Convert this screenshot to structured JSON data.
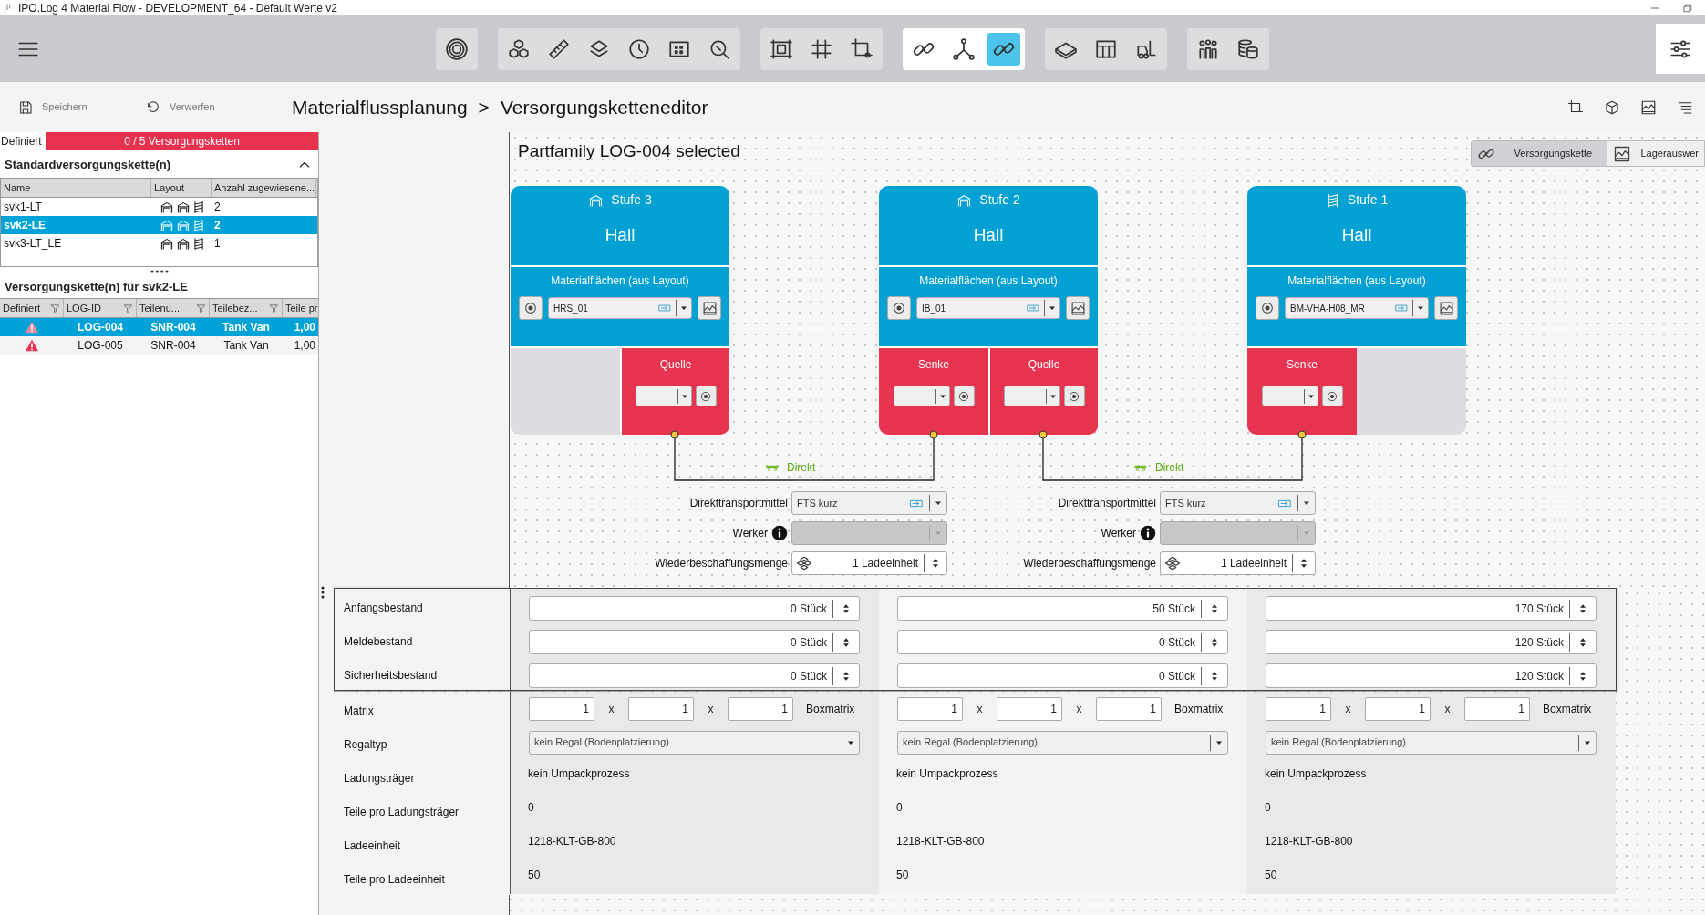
{
  "window": {
    "title": "IPO.Log 4 Material Flow - DEVELOPMENT_64 - Default Werte v2"
  },
  "toolbar": {
    "groups": [
      {
        "active": false,
        "items": [
          {
            "selected": false
          }
        ]
      },
      {
        "active": false,
        "items": [
          {
            "selected": false
          },
          {
            "selected": false
          },
          {
            "selected": false
          },
          {
            "selected": false
          },
          {
            "selected": false
          },
          {
            "selected": false
          }
        ]
      },
      {
        "active": false,
        "items": [
          {
            "selected": false
          },
          {
            "selected": false
          },
          {
            "selected": false
          }
        ]
      },
      {
        "active": true,
        "items": [
          {
            "selected": false
          },
          {
            "selected": false
          },
          {
            "selected": true
          }
        ]
      },
      {
        "active": false,
        "items": [
          {
            "selected": false
          },
          {
            "selected": false
          },
          {
            "selected": false
          }
        ]
      },
      {
        "active": false,
        "items": [
          {
            "selected": false
          },
          {
            "selected": false
          }
        ]
      }
    ]
  },
  "actions": [
    {
      "label": "Speichern",
      "disabled": true
    },
    {
      "label": "Verwerfen",
      "disabled": true
    }
  ],
  "breadcrumb": [
    "Materialflussplanung",
    ">",
    "Versorgungsketteneditor"
  ],
  "left_panel": {
    "defined_label": "Definiert",
    "progress": "0 / 5 Versorgungsketten",
    "level": 0,
    "standard": {
      "title": "Standardversorgungskette(n)",
      "expanded": true,
      "columns": [
        "Name",
        "Layout",
        "Anzahl zugewiesene..."
      ],
      "rows": [
        {
          "name": "svk1-LT",
          "count": "2",
          "selected": false
        },
        {
          "name": "svk2-LE",
          "count": "2",
          "selected": true
        },
        {
          "name": "svk3-LT_LE",
          "count": "1",
          "selected": false
        }
      ]
    },
    "chains": {
      "title": "Versorgungskette(n) für svk2-LE",
      "columns": [
        "Definiert",
        "LOG-ID",
        "Teilenu...",
        "Teilebez...",
        "Teile pr"
      ],
      "rows": [
        {
          "warning": true,
          "log_id": "LOG-004",
          "part_number": "SNR-004",
          "part_name": "Tank Van",
          "quantity": "1,00",
          "selected": true
        },
        {
          "warning": true,
          "log_id": "LOG-005",
          "part_number": "SNR-004",
          "part_name": "Tank Van",
          "quantity": "1,00",
          "selected": false
        }
      ]
    }
  },
  "canvas": {
    "title": "Partfamily LOG-004 selected",
    "view_tabs": [
      {
        "label": "Versorgungskette",
        "selected": true
      },
      {
        "label": "Lagerauswer",
        "selected": false
      }
    ],
    "stages": [
      {
        "title": "Stufe 3",
        "kind": "hall",
        "name": "Hall",
        "areas_label": "Materialflächen (aus Layout)",
        "area": "HRS_01",
        "slots": [
          {
            "kind": "empty"
          },
          {
            "kind": "port",
            "label": "Quelle"
          }
        ]
      },
      {
        "title": "Stufe 2",
        "kind": "hall",
        "name": "Hall",
        "areas_label": "Materialflächen (aus Layout)",
        "area": "IB_01",
        "slots": [
          {
            "kind": "port",
            "label": "Senke"
          },
          {
            "kind": "port",
            "label": "Quelle"
          }
        ]
      },
      {
        "title": "Stufe 1",
        "kind": "rack",
        "name": "Hall",
        "areas_label": "Materialflächen (aus Layout)",
        "area": "BM-VHA-H08_MR",
        "slots": [
          {
            "kind": "port",
            "label": "Senke"
          },
          {
            "kind": "empty"
          }
        ]
      }
    ],
    "links": [
      {
        "label": "Direkt",
        "fields": [
          {
            "kind": "transport",
            "label": "Direkttransportmittel",
            "value": "FTS kurz"
          },
          {
            "kind": "worker",
            "label": "Werker",
            "disabled": true
          },
          {
            "kind": "quantity",
            "label": "Wiederbeschaffungsmenge",
            "value": "1 Ladeeinheit"
          }
        ]
      },
      {
        "label": "Direkt",
        "fields": [
          {
            "kind": "transport",
            "label": "Direkttransportmittel",
            "value": "FTS kurz"
          },
          {
            "kind": "worker",
            "label": "Werker",
            "disabled": true
          },
          {
            "kind": "quantity",
            "label": "Wiederbeschaffungsmenge",
            "value": "1 Ladeeinheit"
          }
        ]
      }
    ]
  },
  "properties": {
    "rows": [
      {
        "kind": "spin",
        "label": "Anfangsbestand",
        "grouped": true,
        "values": [
          "0 Stück",
          "50 Stück",
          "170 Stück"
        ]
      },
      {
        "kind": "spin",
        "label": "Meldebestand",
        "grouped": true,
        "values": [
          "0 Stück",
          "0 Stück",
          "120 Stück"
        ]
      },
      {
        "kind": "spin",
        "label": "Sicherheitsbestand",
        "grouped": true,
        "values": [
          "0 Stück",
          "0 Stück",
          "120 Stück"
        ]
      },
      {
        "kind": "matrix",
        "label": "Matrix",
        "grouped": false,
        "values": [
          {
            "cells": [
              "1",
              "1",
              "1"
            ],
            "separators": [
              "x",
              "x"
            ],
            "unit": "Boxmatrix"
          },
          {
            "cells": [
              "1",
              "1",
              "1"
            ],
            "separators": [
              "x",
              "x"
            ],
            "unit": "Boxmatrix"
          },
          {
            "cells": [
              "1",
              "1",
              "1"
            ],
            "separators": [
              "x",
              "x"
            ],
            "unit": "Boxmatrix"
          }
        ]
      },
      {
        "kind": "select",
        "label": "Regaltyp",
        "grouped": false,
        "values": [
          "kein Regal (Bodenplatzierung)",
          "kein Regal (Bodenplatzierung)",
          "kein Regal (Bodenplatzierung)"
        ]
      },
      {
        "kind": "text",
        "label": "Ladungsträger",
        "grouped": false,
        "values": [
          "kein Umpackprozess",
          "kein Umpackprozess",
          "kein Umpackprozess"
        ]
      },
      {
        "kind": "text",
        "label": "Teile pro Ladungsträger",
        "grouped": false,
        "values": [
          "0",
          "0",
          "0"
        ]
      },
      {
        "kind": "text",
        "label": "Ladeeinheit",
        "grouped": false,
        "values": [
          "1218-KLT-GB-800",
          "1218-KLT-GB-800",
          "1218-KLT-GB-800"
        ]
      },
      {
        "kind": "text",
        "label": "Teile pro Ladeeinheit",
        "grouped": false,
        "values": [
          "50",
          "50",
          "50"
        ]
      }
    ]
  }
}
